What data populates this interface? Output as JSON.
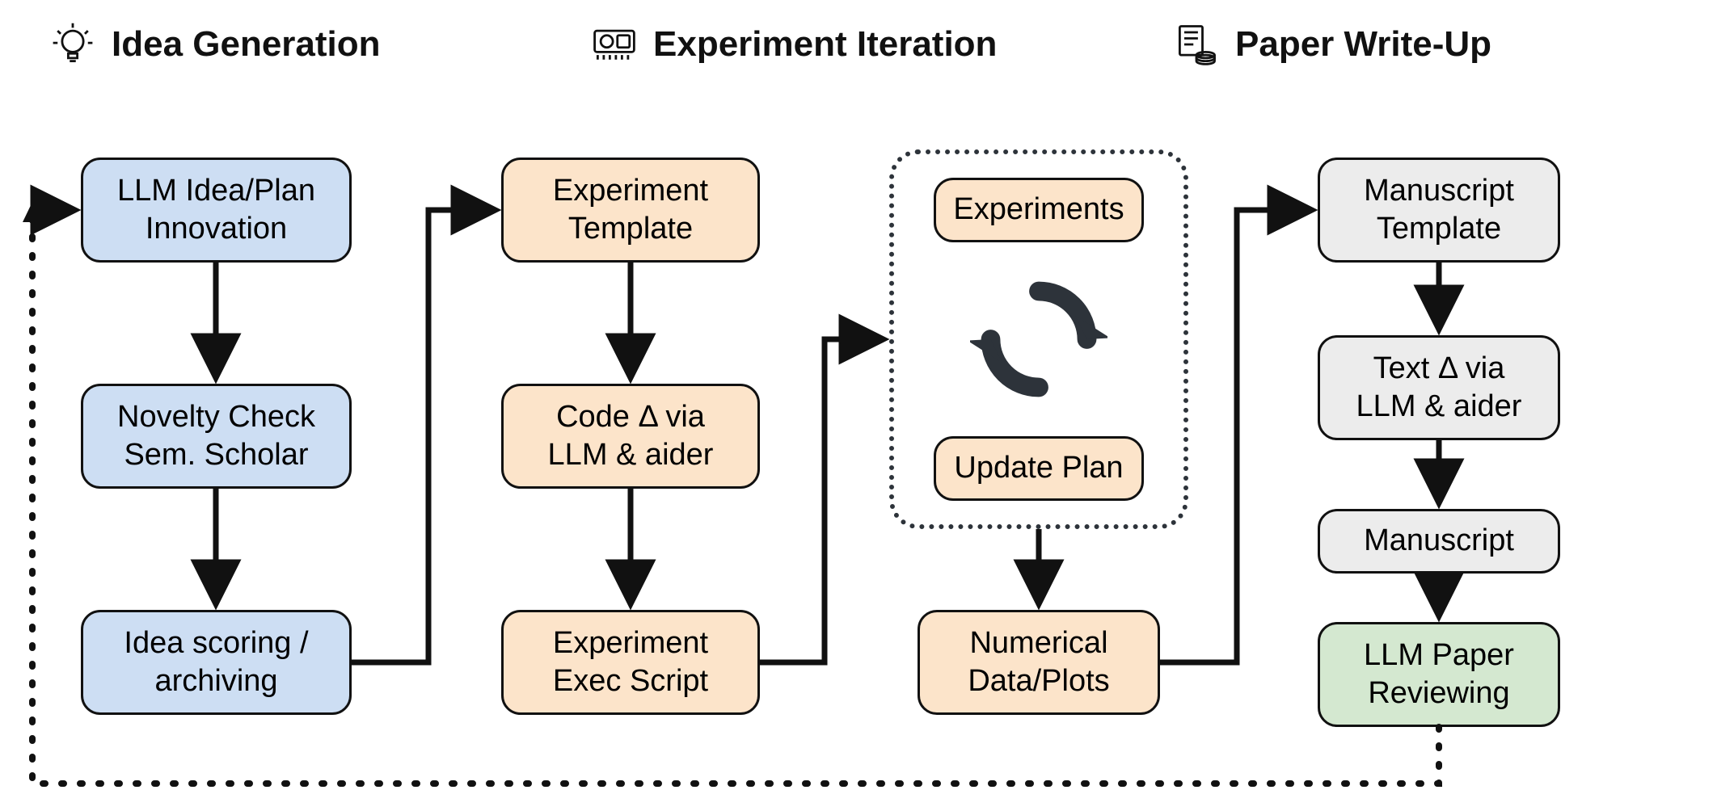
{
  "sections": {
    "idea": {
      "title": "Idea Generation"
    },
    "exp": {
      "title": "Experiment Iteration"
    },
    "paper": {
      "title": "Paper Write-Up"
    }
  },
  "nodes": {
    "llm_idea": "LLM Idea/Plan\nInnovation",
    "novelty": "Novelty Check\nSem. Scholar",
    "scoring": "Idea scoring /\narchiving",
    "exp_template": "Experiment\nTemplate",
    "code_delta": "Code Δ via\nLLM & aider",
    "exec_script": "Experiment\nExec Script",
    "experiments": "Experiments",
    "update_plan": "Update Plan",
    "num_data": "Numerical\nData/Plots",
    "manu_template": "Manuscript\nTemplate",
    "text_delta": "Text Δ via\nLLM & aider",
    "manuscript": "Manuscript",
    "reviewing": "LLM Paper\nReviewing"
  }
}
